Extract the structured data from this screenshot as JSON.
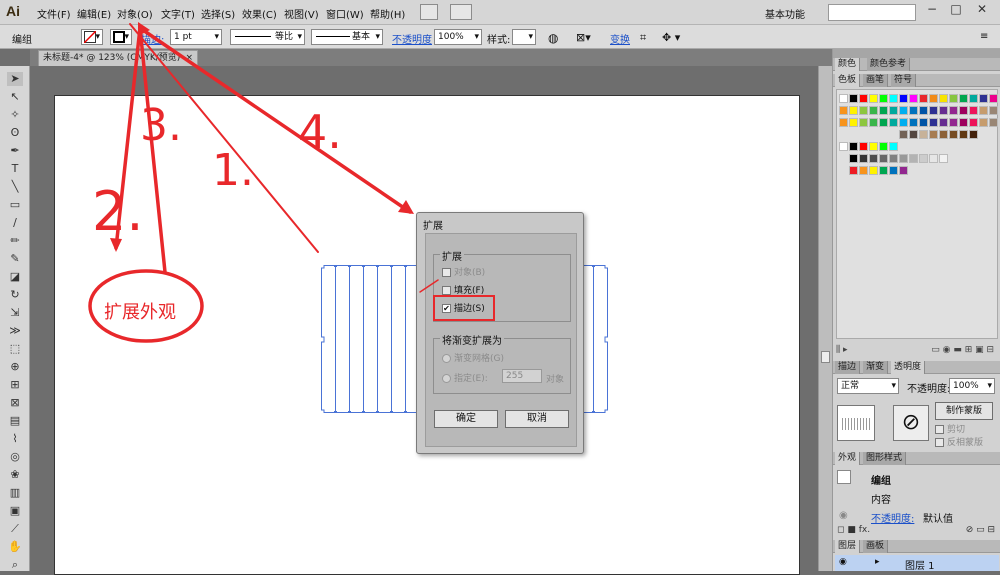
{
  "menubar": {
    "logo": "Ai",
    "items": [
      "文件(F)",
      "编辑(E)",
      "对象(O)",
      "文字(T)",
      "选择(S)",
      "效果(C)",
      "视图(V)",
      "窗口(W)",
      "帮助(H)"
    ],
    "workspace": "基本功能",
    "win_min": "−",
    "win_max": "□",
    "win_close": "✕"
  },
  "controlbar": {
    "selection": "编组",
    "stroke_label": "描边:",
    "stroke_value": "1 pt",
    "profile_label": "等比",
    "brush_label": "基本",
    "opacity_label": "不透明度",
    "opacity_value": "100%",
    "style_label": "样式:",
    "transform_label": "变换"
  },
  "document": {
    "tab_title": "未标题-4* @ 123% (CMYK/预览)",
    "tab_close": "×"
  },
  "dialog": {
    "title": "扩展",
    "expand_group": "扩展",
    "opt_object": "对象(B)",
    "opt_fill": "填充(F)",
    "opt_stroke": "描边(S)",
    "gradient_group": "将渐变扩展为",
    "opt_gradient_mesh": "渐变网格(G)",
    "opt_specify": "指定(E):",
    "specify_value": "255",
    "specify_unit": "对象",
    "ok": "确定",
    "cancel": "取消",
    "stroke_checked": true
  },
  "panels": {
    "color_tabs": [
      "颜色",
      "颜色参考"
    ],
    "swatch_tabs": [
      "色板",
      "画笔",
      "符号"
    ],
    "stroke_tabs": [
      "描边",
      "渐变",
      "透明度"
    ],
    "blend_mode": "正常",
    "opacity_label": "不透明度:",
    "opacity_value": "100%",
    "make_mask": "制作蒙版",
    "clip": "剪切",
    "invert_mask": "反相蒙版",
    "appearance_tabs": [
      "外观",
      "图形样式"
    ],
    "appearance_group": "编组",
    "appearance_content": "内容",
    "appearance_opacity_label": "不透明度:",
    "appearance_opacity_value": "默认值",
    "layers_tabs": [
      "图层",
      "画板"
    ],
    "layer_name": "图层 1"
  },
  "annotations": {
    "handwritten_note": "扩展外观",
    "step_numbers": [
      "1.",
      "2.",
      "3.",
      "4."
    ],
    "accent_color": "#e8282b"
  },
  "swatch_colors": {
    "row1": [
      "#ffffff",
      "#000000",
      "#ff0000",
      "#ffff00",
      "#00ff00",
      "#00ffff",
      "#0000ff",
      "#ff00ff",
      "#e8252b",
      "#f08b18",
      "#f7e400",
      "#87c540",
      "#00a64f",
      "#00a99d",
      "#2e3192",
      "#ec008c"
    ],
    "row2": [
      "#f7941d",
      "#fff200",
      "#8dc63f",
      "#39b54a",
      "#00a651",
      "#00a99d",
      "#00aeef",
      "#0072bc",
      "#0054a6",
      "#2e3192",
      "#662d91",
      "#92278f",
      "#9e005d",
      "#ed145b",
      "#c69c6d",
      "#998675"
    ],
    "row3": [
      "#736357",
      "#534741",
      "#c7b299",
      "#a67c52",
      "#8c6239",
      "#754c24",
      "#603913",
      "#42210b"
    ],
    "greys": [
      "#000000",
      "#333333",
      "#4d4d4d",
      "#666666",
      "#808080",
      "#999999",
      "#b3b3b3",
      "#cccccc",
      "#e6e6e6",
      "#f2f2f2"
    ],
    "group2": [
      "#ed1c24",
      "#f7941d",
      "#fff200",
      "#00a651",
      "#0072bc",
      "#92278f"
    ]
  }
}
